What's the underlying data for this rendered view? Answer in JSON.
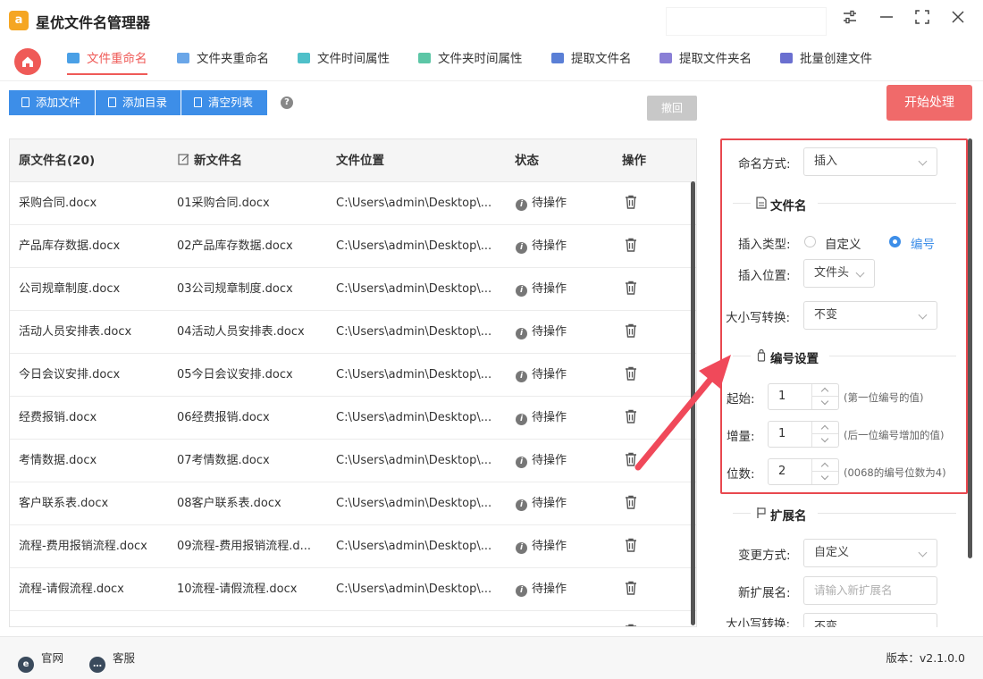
{
  "app": {
    "title": "星优文件名管理器",
    "logo_text": "a"
  },
  "tabs": [
    {
      "label": "文件重命名",
      "active": true,
      "color": "#4aa0e6"
    },
    {
      "label": "文件夹重命名",
      "active": false,
      "color": "#6aa6e8"
    },
    {
      "label": "文件时间属性",
      "active": false,
      "color": "#4fc0c9"
    },
    {
      "label": "文件夹时间属性",
      "active": false,
      "color": "#5cc6a6"
    },
    {
      "label": "提取文件名",
      "active": false,
      "color": "#5a7fd6"
    },
    {
      "label": "提取文件夹名",
      "active": false,
      "color": "#8a7fd6"
    },
    {
      "label": "批量创建文件",
      "active": false,
      "color": "#6a6fd0"
    }
  ],
  "toolbar": {
    "add_file": "添加文件",
    "add_dir": "添加目录",
    "clear_list": "清空列表",
    "help": "?",
    "undo": "撤回",
    "start": "开始处理"
  },
  "table": {
    "headers": {
      "original": "原文件名(20)",
      "new_name": "新文件名",
      "location": "文件位置",
      "status": "状态",
      "action": "操作"
    },
    "rows": [
      {
        "original": "采购合同.docx",
        "new_name": "01采购合同.docx",
        "location": "C:\\Users\\admin\\Desktop\\...",
        "status": "待操作"
      },
      {
        "original": "产品库存数据.docx",
        "new_name": "02产品库存数据.docx",
        "location": "C:\\Users\\admin\\Desktop\\...",
        "status": "待操作"
      },
      {
        "original": "公司规章制度.docx",
        "new_name": "03公司规章制度.docx",
        "location": "C:\\Users\\admin\\Desktop\\...",
        "status": "待操作"
      },
      {
        "original": "活动人员安排表.docx",
        "new_name": "04活动人员安排表.docx",
        "location": "C:\\Users\\admin\\Desktop\\...",
        "status": "待操作"
      },
      {
        "original": "今日会议安排.docx",
        "new_name": "05今日会议安排.docx",
        "location": "C:\\Users\\admin\\Desktop\\...",
        "status": "待操作"
      },
      {
        "original": "经费报销.docx",
        "new_name": "06经费报销.docx",
        "location": "C:\\Users\\admin\\Desktop\\...",
        "status": "待操作"
      },
      {
        "original": "考情数据.docx",
        "new_name": "07考情数据.docx",
        "location": "C:\\Users\\admin\\Desktop\\...",
        "status": "待操作"
      },
      {
        "original": "客户联系表.docx",
        "new_name": "08客户联系表.docx",
        "location": "C:\\Users\\admin\\Desktop\\...",
        "status": "待操作"
      },
      {
        "original": "流程-费用报销流程.docx",
        "new_name": "09流程-费用报销流程.d...",
        "location": "C:\\Users\\admin\\Desktop\\...",
        "status": "待操作"
      },
      {
        "original": "流程-请假流程.docx",
        "new_name": "10流程-请假流程.docx",
        "location": "C:\\Users\\admin\\Desktop\\...",
        "status": "待操作"
      }
    ]
  },
  "panel": {
    "naming_mode_label": "命名方式:",
    "naming_mode_value": "插入",
    "filename_section": "文件名",
    "insert_type_label": "插入类型:",
    "insert_type_options": [
      "自定义",
      "编号"
    ],
    "insert_type_selected": "编号",
    "insert_pos_label": "插入位置:",
    "insert_pos_value": "文件头",
    "case_label": "大小写转换:",
    "case_value": "不变",
    "numbering_section": "编号设置",
    "start_label": "起始:",
    "start_value": "1",
    "start_hint": "(第一位编号的值)",
    "step_label": "增量:",
    "step_value": "1",
    "step_hint": "(后一位编号增加的值)",
    "digits_label": "位数:",
    "digits_value": "2",
    "digits_hint": "(0068的编号位数为4)",
    "ext_section": "扩展名",
    "change_mode_label": "变更方式:",
    "change_mode_value": "自定义",
    "new_ext_label": "新扩展名:",
    "new_ext_placeholder": "请输入新扩展名",
    "ext_case_label": "大小写转换:",
    "ext_case_value": "不变"
  },
  "footer": {
    "website": "官网",
    "support": "客服",
    "version": "版本：v2.1.0.0"
  },
  "colors": {
    "accent": "#ef5a57",
    "primary": "#3d8ee8",
    "highlight": "#e8484f"
  }
}
